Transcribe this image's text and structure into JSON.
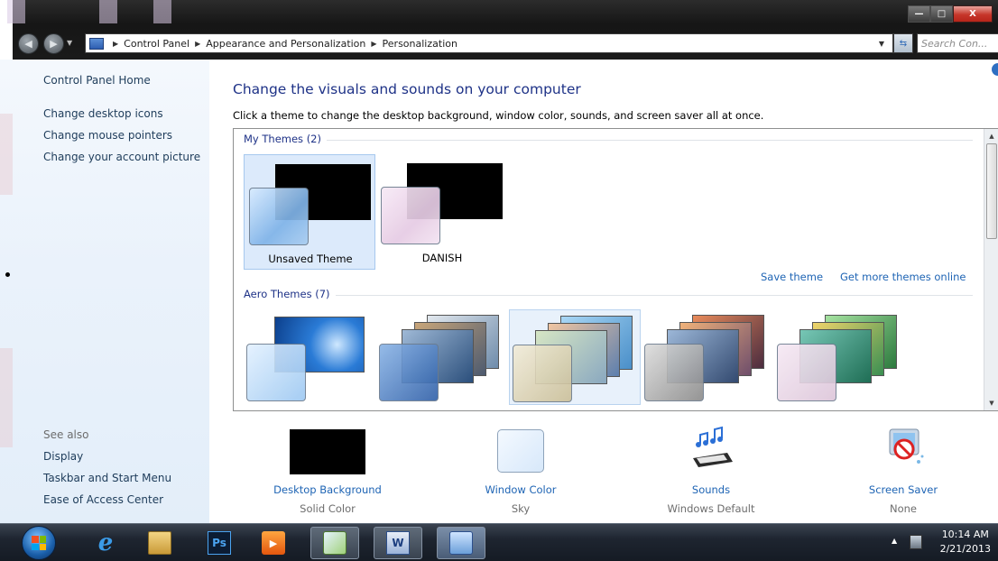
{
  "window": {
    "breadcrumbs": [
      "Control Panel",
      "Appearance and Personalization",
      "Personalization"
    ],
    "search_placeholder": "Search Con...",
    "controls": {
      "minimize": "—",
      "maximize": "□",
      "close": "X"
    }
  },
  "sidebar": {
    "home": "Control Panel Home",
    "links": [
      "Change desktop icons",
      "Change mouse pointers",
      "Change your account picture"
    ],
    "see_also_heading": "See also",
    "see_also": [
      "Display",
      "Taskbar and Start Menu",
      "Ease of Access Center"
    ]
  },
  "main": {
    "title": "Change the visuals and sounds on your computer",
    "subtitle": "Click a theme to change the desktop background, window color, sounds, and screen saver all at once.",
    "my_themes_heading": "My Themes (2)",
    "my_themes": [
      {
        "name": "Unsaved Theme",
        "selected": true
      },
      {
        "name": "DANISH",
        "selected": false
      }
    ],
    "save_theme": "Save theme",
    "get_more": "Get more themes online",
    "aero_heading": "Aero Themes (7)"
  },
  "settings": [
    {
      "label": "Desktop Background",
      "value": "Solid Color",
      "icon": "black-swatch-icon"
    },
    {
      "label": "Window Color",
      "value": "Sky",
      "icon": "sky-color-swatch-icon"
    },
    {
      "label": "Sounds",
      "value": "Windows Default",
      "icon": "music-notes-icon"
    },
    {
      "label": "Screen Saver",
      "value": "None",
      "icon": "screen-saver-icon"
    }
  ],
  "taskbar": {
    "apps": [
      "internet-explorer-icon",
      "file-explorer-icon",
      "photoshop-icon",
      "media-player-icon",
      "paint-icon",
      "word-icon",
      "control-panel-icon"
    ],
    "photoshop_label": "Ps",
    "word_label": "W",
    "time": "10:14 AM",
    "date": "2/21/2013"
  },
  "colors": {
    "title_blue": "#1e3287",
    "link_blue": "#1e64b4",
    "selection": "#dceafb"
  }
}
